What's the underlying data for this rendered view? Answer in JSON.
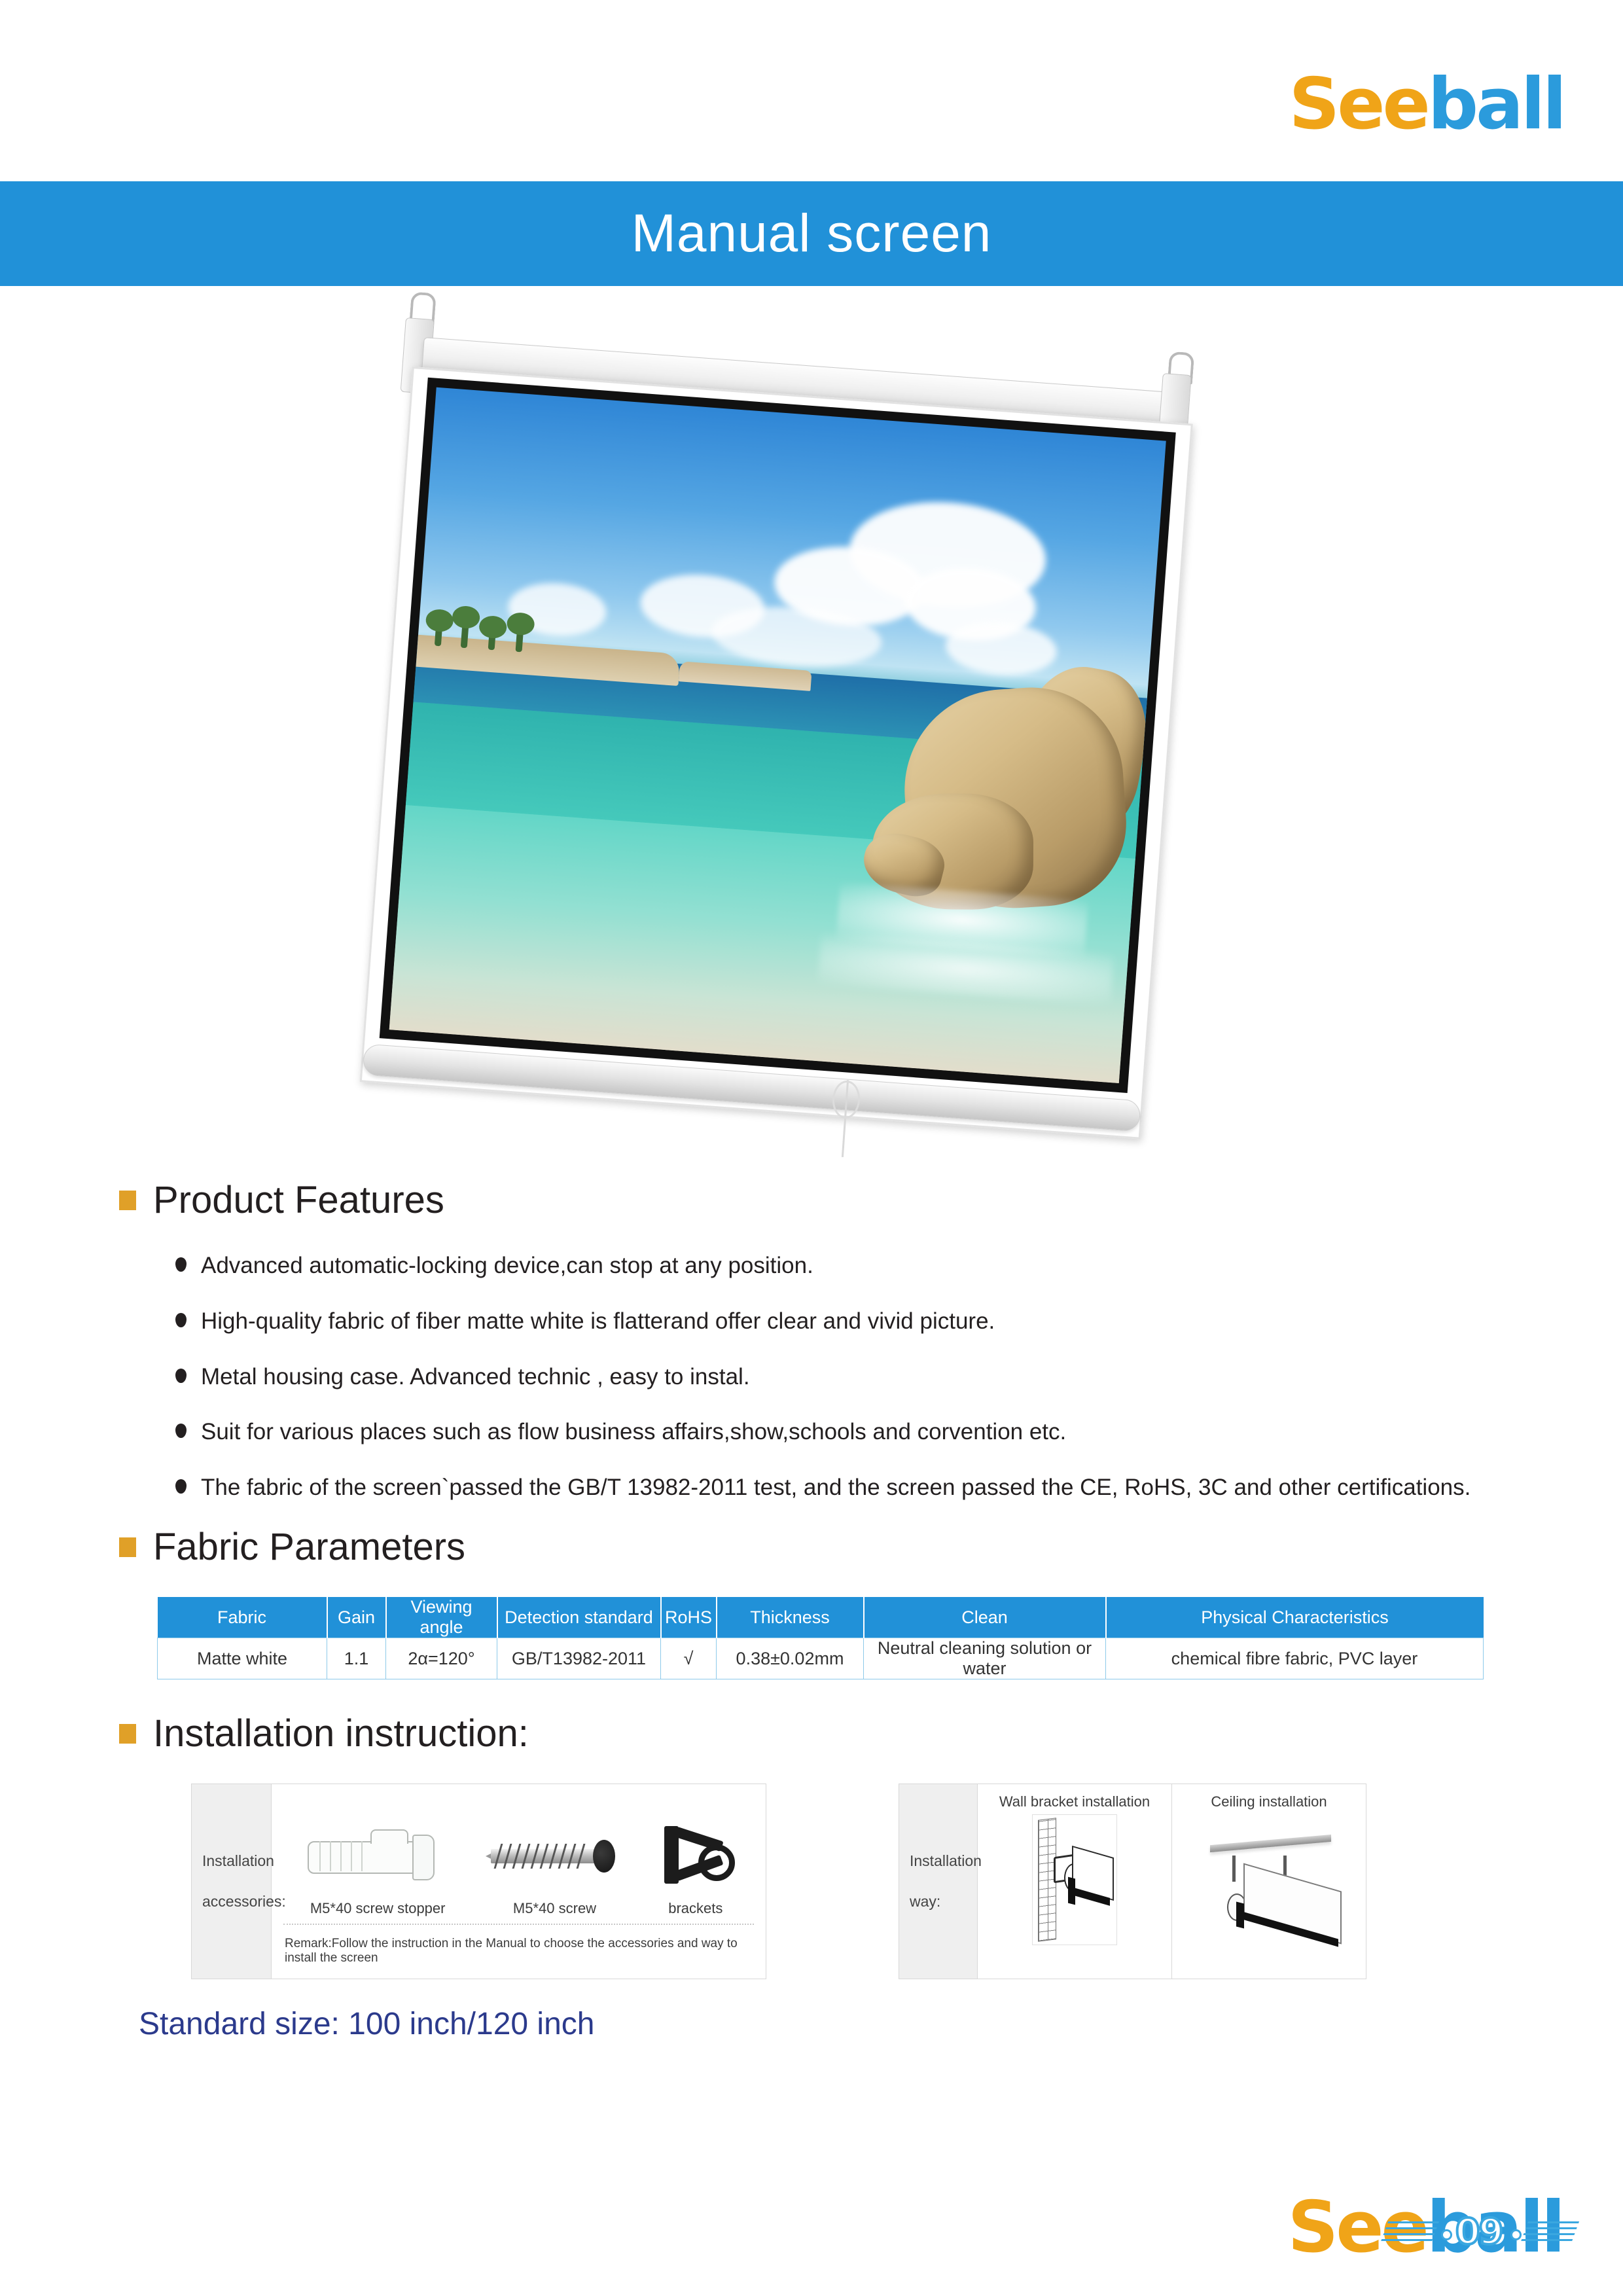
{
  "brand": {
    "logo_see": "See",
    "logo_ball": "ball",
    "accent_orange": "#F0A418",
    "accent_blue": "#2B9BDC"
  },
  "header": {
    "title": "Manual screen",
    "banner_color": "#2191D8"
  },
  "hero": {
    "alt": "manual-pull-down-projection-screen-with-beach-scene"
  },
  "sections": {
    "features_heading": "Product Features",
    "fabric_heading": "Fabric Parameters",
    "install_heading": "Installation instruction:",
    "bullet_color": "#E0A028"
  },
  "features": [
    "Advanced automatic-locking device,can stop at any position.",
    "High-quality fabric of fiber matte white is flatterand offer clear and vivid picture.",
    "Metal housing case. Advanced technic , easy to instal.",
    "Suit for various places such as flow business affairs,show,schools and corvention etc.",
    "The fabric of the screen`passed the GB/T 13982-2011 test, and the screen passed the CE, RoHS, 3C and other certifications."
  ],
  "fabric_table": {
    "headers": [
      "Fabric",
      "Gain",
      "Viewing angle",
      "Detection standard",
      "RoHS",
      "Thickness",
      "Clean",
      "Physical Characteristics"
    ],
    "rows": [
      [
        "Matte white",
        "1.1",
        "2α=120°",
        "GB/T13982-2011",
        "√",
        "0.38±0.02mm",
        "Neutral cleaning solution or water",
        "chemical fibre fabric, PVC layer"
      ]
    ],
    "header_bg": "#2191D8",
    "border_color": "#8ecaea"
  },
  "installation": {
    "accessories": {
      "label": "Installation\naccessories:",
      "label_line1": "Installation",
      "label_line2": "accessories:",
      "items": [
        {
          "name": "M5*40 screw stopper",
          "icon": "plastic-wall-anchor-icon"
        },
        {
          "name": "M5*40 screw",
          "icon": "screw-icon"
        },
        {
          "name": "brackets",
          "icon": "bracket-icon"
        }
      ],
      "remark": "Remark:Follow the instruction in the Manual to choose the accessories and way to install the screen"
    },
    "way": {
      "label_line1": "Installation",
      "label_line2": "way:",
      "options": [
        {
          "name": "Wall bracket installation",
          "icon": "wall-bracket-diagram-icon"
        },
        {
          "name": "Ceiling installation",
          "icon": "ceiling-mount-diagram-icon"
        }
      ]
    }
  },
  "standard_size": "Standard size: 100 inch/120 inch",
  "footer": {
    "logo_see": "See",
    "logo_ball": "ball",
    "page_number": "09"
  }
}
